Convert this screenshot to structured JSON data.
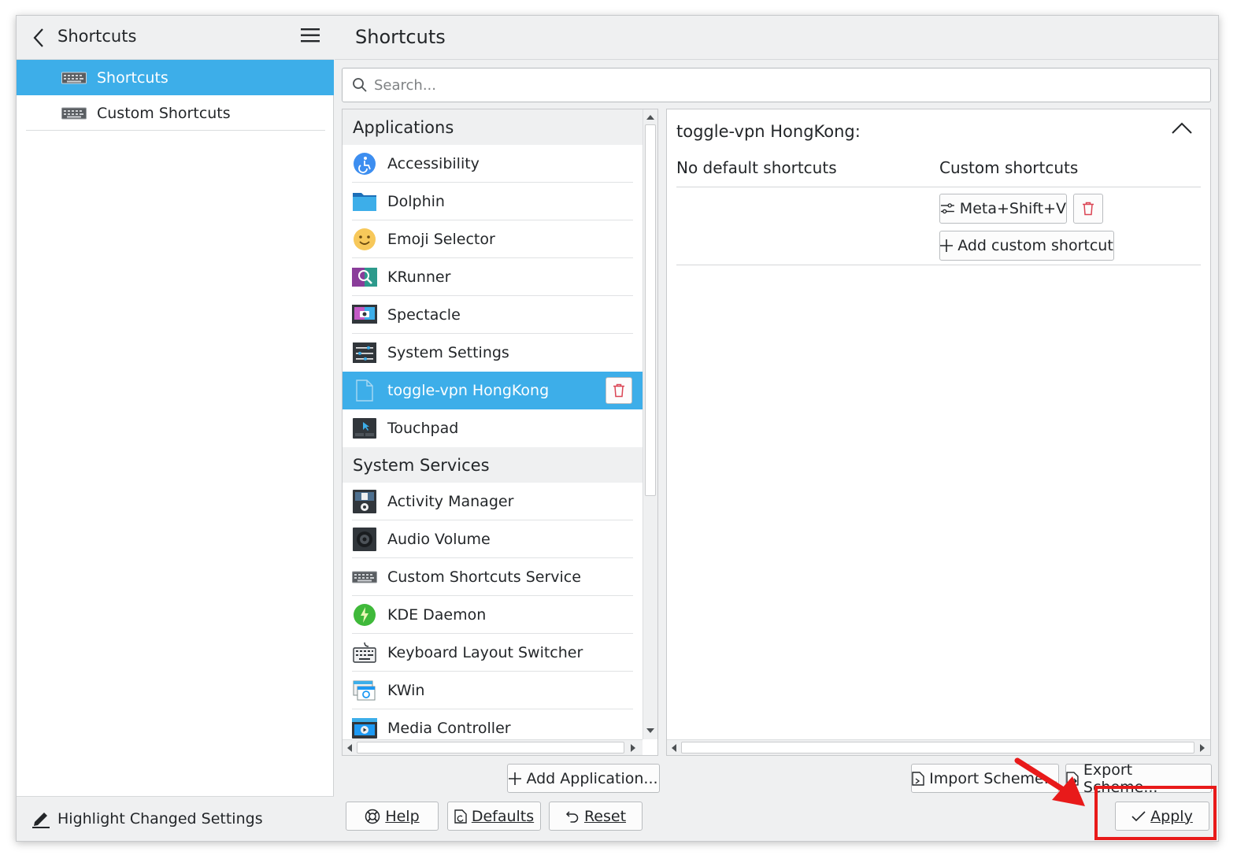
{
  "sidebar": {
    "title": "Shortcuts",
    "items": [
      {
        "label": "Shortcuts"
      },
      {
        "label": "Custom Shortcuts"
      }
    ],
    "footer_label": "Highlight Changed Settings"
  },
  "main": {
    "title": "Shortcuts",
    "search_placeholder": "Search..."
  },
  "list": {
    "sections": [
      {
        "title": "Applications",
        "items": [
          {
            "label": "Accessibility"
          },
          {
            "label": "Dolphin"
          },
          {
            "label": "Emoji Selector"
          },
          {
            "label": "KRunner"
          },
          {
            "label": "Spectacle"
          },
          {
            "label": "System Settings"
          },
          {
            "label": "toggle-vpn HongKong"
          },
          {
            "label": "Touchpad"
          }
        ]
      },
      {
        "title": "System Services",
        "items": [
          {
            "label": "Activity Manager"
          },
          {
            "label": "Audio Volume"
          },
          {
            "label": "Custom Shortcuts Service"
          },
          {
            "label": "KDE Daemon"
          },
          {
            "label": "Keyboard Layout Switcher"
          },
          {
            "label": "KWin"
          },
          {
            "label": "Media Controller"
          }
        ]
      }
    ]
  },
  "detail": {
    "title": "toggle-vpn HongKong:",
    "default_header": "No default shortcuts",
    "custom_header": "Custom shortcuts",
    "shortcut": "Meta+Shift+V",
    "add_custom": "Add custom shortcut"
  },
  "buttons": {
    "add_application": "Add Application...",
    "import_scheme": "Import Scheme...",
    "export_scheme": "Export Scheme...",
    "help": "Help",
    "defaults": "Defaults",
    "reset": "Reset",
    "apply": "Apply"
  },
  "colors": {
    "selection": "#3daee9",
    "annotation": "#e81a1a"
  }
}
